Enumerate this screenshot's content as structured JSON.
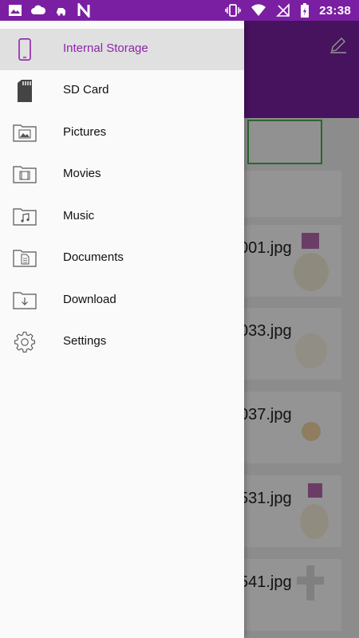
{
  "status_bar": {
    "time": "23:38",
    "left_icons": [
      "image-icon",
      "cloud-icon",
      "car-icon",
      "n-icon"
    ],
    "right_icons": [
      "vibrate-icon",
      "wifi-icon",
      "no-sim-icon",
      "battery-charging-icon"
    ]
  },
  "drawer": {
    "items": [
      {
        "label": "Internal Storage",
        "icon": "phone-icon",
        "active": true
      },
      {
        "label": "SD Card",
        "icon": "sd-card-icon",
        "active": false
      },
      {
        "label": "Pictures",
        "icon": "pictures-folder-icon",
        "active": false
      },
      {
        "label": "Movies",
        "icon": "movies-folder-icon",
        "active": false
      },
      {
        "label": "Music",
        "icon": "music-folder-icon",
        "active": false
      },
      {
        "label": "Documents",
        "icon": "documents-folder-icon",
        "active": false
      },
      {
        "label": "Download",
        "icon": "download-folder-icon",
        "active": false
      },
      {
        "label": "Settings",
        "icon": "gear-icon",
        "active": false
      }
    ]
  },
  "background_files": [
    {
      "name": "001.jpg"
    },
    {
      "name": "033.jpg"
    },
    {
      "name": "037.jpg"
    },
    {
      "name": "531.jpg"
    },
    {
      "name": "541.jpg"
    }
  ],
  "colors": {
    "primary": "#7b1fa2",
    "accent": "#8e24aa",
    "active_row": "#e0e0e0"
  }
}
